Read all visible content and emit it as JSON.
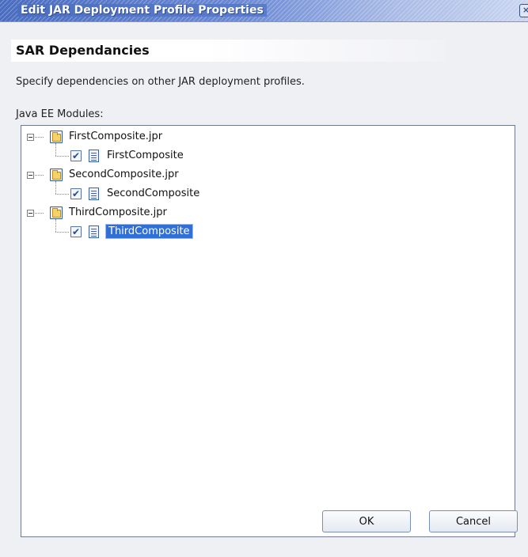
{
  "window": {
    "title": "Edit JAR Deployment Profile Properties"
  },
  "page": {
    "header": "SAR Dependancies",
    "description": "Specify dependencies on other JAR deployment profiles.",
    "modules_label_mnemonic": "J",
    "modules_label_rest": "ava EE Modules:"
  },
  "tree": {
    "nodes": [
      {
        "label": "FirstComposite.jpr",
        "expanded": true,
        "children": [
          {
            "label": "FirstComposite",
            "checked": true,
            "selected": false
          }
        ]
      },
      {
        "label": "SecondComposite.jpr",
        "expanded": true,
        "children": [
          {
            "label": "SecondComposite",
            "checked": true,
            "selected": false
          }
        ]
      },
      {
        "label": "ThirdComposite.jpr",
        "expanded": true,
        "children": [
          {
            "label": "ThirdComposite",
            "checked": true,
            "selected": true
          }
        ]
      }
    ]
  },
  "buttons": {
    "ok": "OK",
    "cancel": "Cancel"
  },
  "colors": {
    "selection": "#2f6fd6",
    "selection_border": "#f0b043",
    "titlebar": "#4a6cc0"
  },
  "icons": {
    "project": "folder-icon",
    "composite": "document-icon",
    "checkmark": "✔",
    "close": "×"
  }
}
